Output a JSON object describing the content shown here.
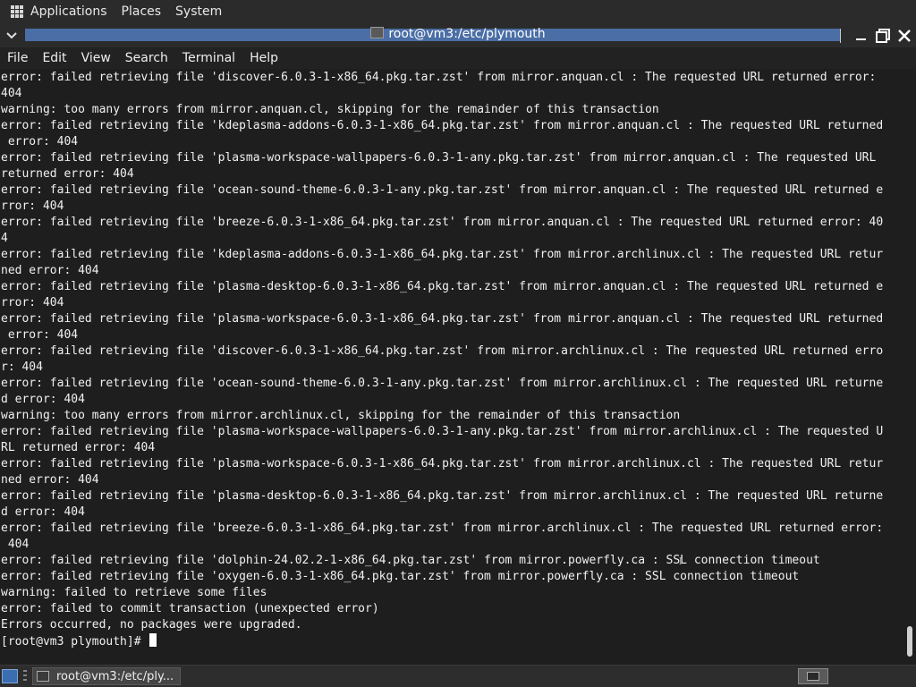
{
  "top_panel": {
    "menus": [
      "Applications",
      "Places",
      "System"
    ]
  },
  "window": {
    "title": "root@vm3:/etc/plymouth"
  },
  "menubar": {
    "items": [
      "File",
      "Edit",
      "View",
      "Search",
      "Terminal",
      "Help"
    ]
  },
  "terminal": {
    "lines": [
      "error: failed retrieving file 'discover-6.0.3-1-x86_64.pkg.tar.zst' from mirror.anquan.cl : The requested URL returned error:",
      "404",
      "warning: too many errors from mirror.anquan.cl, skipping for the remainder of this transaction",
      "error: failed retrieving file 'kdeplasma-addons-6.0.3-1-x86_64.pkg.tar.zst' from mirror.anquan.cl : The requested URL returned",
      " error: 404",
      "error: failed retrieving file 'plasma-workspace-wallpapers-6.0.3-1-any.pkg.tar.zst' from mirror.anquan.cl : The requested URL",
      "returned error: 404",
      "error: failed retrieving file 'ocean-sound-theme-6.0.3-1-any.pkg.tar.zst' from mirror.anquan.cl : The requested URL returned e",
      "rror: 404",
      "error: failed retrieving file 'breeze-6.0.3-1-x86_64.pkg.tar.zst' from mirror.anquan.cl : The requested URL returned error: 40",
      "4",
      "error: failed retrieving file 'kdeplasma-addons-6.0.3-1-x86_64.pkg.tar.zst' from mirror.archlinux.cl : The requested URL retur",
      "ned error: 404",
      "error: failed retrieving file 'plasma-desktop-6.0.3-1-x86_64.pkg.tar.zst' from mirror.anquan.cl : The requested URL returned e",
      "rror: 404",
      "error: failed retrieving file 'plasma-workspace-6.0.3-1-x86_64.pkg.tar.zst' from mirror.anquan.cl : The requested URL returned",
      " error: 404",
      "error: failed retrieving file 'discover-6.0.3-1-x86_64.pkg.tar.zst' from mirror.archlinux.cl : The requested URL returned erro",
      "r: 404",
      "error: failed retrieving file 'ocean-sound-theme-6.0.3-1-any.pkg.tar.zst' from mirror.archlinux.cl : The requested URL returne",
      "d error: 404",
      "warning: too many errors from mirror.archlinux.cl, skipping for the remainder of this transaction",
      "error: failed retrieving file 'plasma-workspace-wallpapers-6.0.3-1-any.pkg.tar.zst' from mirror.archlinux.cl : The requested U",
      "RL returned error: 404",
      "error: failed retrieving file 'plasma-workspace-6.0.3-1-x86_64.pkg.tar.zst' from mirror.archlinux.cl : The requested URL retur",
      "ned error: 404",
      "error: failed retrieving file 'plasma-desktop-6.0.3-1-x86_64.pkg.tar.zst' from mirror.archlinux.cl : The requested URL returne",
      "d error: 404",
      "error: failed retrieving file 'breeze-6.0.3-1-x86_64.pkg.tar.zst' from mirror.archlinux.cl : The requested URL returned error:",
      " 404",
      "error: failed retrieving file 'dolphin-24.02.2-1-x86_64.pkg.tar.zst' from mirror.powerfly.ca : SSL connection timeout",
      "error: failed retrieving file 'oxygen-6.0.3-1-x86_64.pkg.tar.zst' from mirror.powerfly.ca : SSL connection timeout",
      "warning: failed to retrieve some files",
      "error: failed to commit transaction (unexpected error)",
      "Errors occurred, no packages were upgraded."
    ],
    "prompt": "[root@vm3 plymouth]# "
  },
  "taskbar": {
    "task_label": "root@vm3:/etc/ply..."
  }
}
